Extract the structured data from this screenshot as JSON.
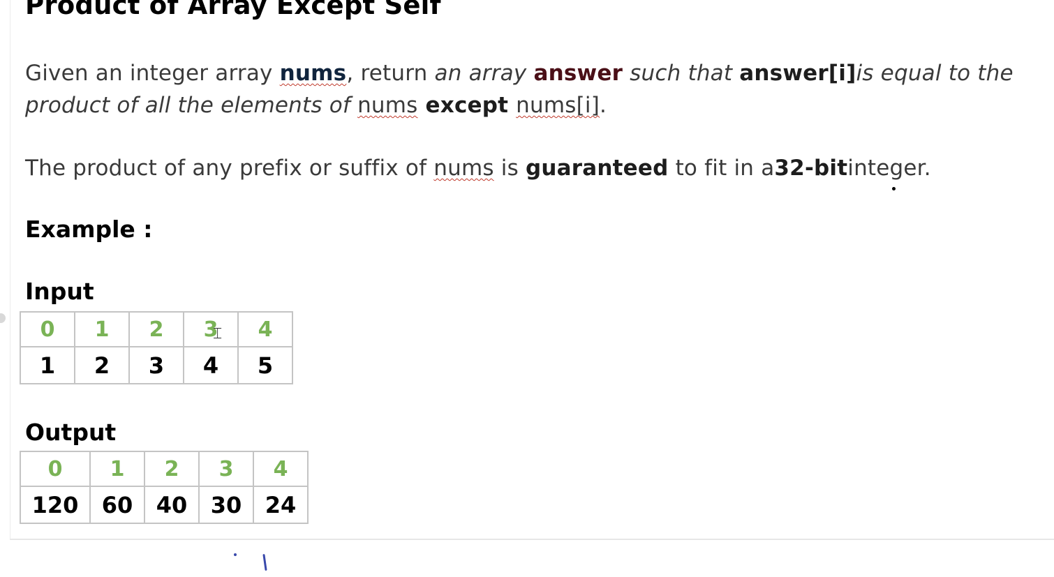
{
  "title": "Product of Array Except Self",
  "description": {
    "line1": {
      "t1": "Given an integer array ",
      "nums": "nums",
      "t2": ", return ",
      "t3": "an array ",
      "answer": "answer",
      "t4": " such that ",
      "answer_i": "answer[i]",
      "t5": "is equal to the"
    },
    "line2": {
      "t1": "product of all the elements of ",
      "nums": "nums",
      "except": " except ",
      "nums_i": "nums[i]",
      "t2": "."
    },
    "line3": {
      "t1": "The product of any prefix or suffix of ",
      "nums": "nums",
      "t2": " is ",
      "guaranteed": "guaranteed",
      "t3": " to fit in a",
      "bits": "32-bit",
      "t4": "integer."
    }
  },
  "example_heading": "Example :",
  "input": {
    "label": "Input",
    "indices": [
      "0",
      "1",
      "2",
      "3",
      "4"
    ],
    "values": [
      "1",
      "2",
      "3",
      "4",
      "5"
    ]
  },
  "output": {
    "label": "Output",
    "indices": [
      "0",
      "1",
      "2",
      "3",
      "4"
    ],
    "values": [
      "120",
      "60",
      "40",
      "30",
      "24"
    ]
  },
  "colors": {
    "index_green": "#7ab356",
    "nums_navy": "#10243d",
    "answer_maroon": "#4a0f17",
    "cell_border": "#c4c4c4",
    "pen_blue": "#3949ab"
  },
  "icons": [
    "text-cursor-icon"
  ]
}
